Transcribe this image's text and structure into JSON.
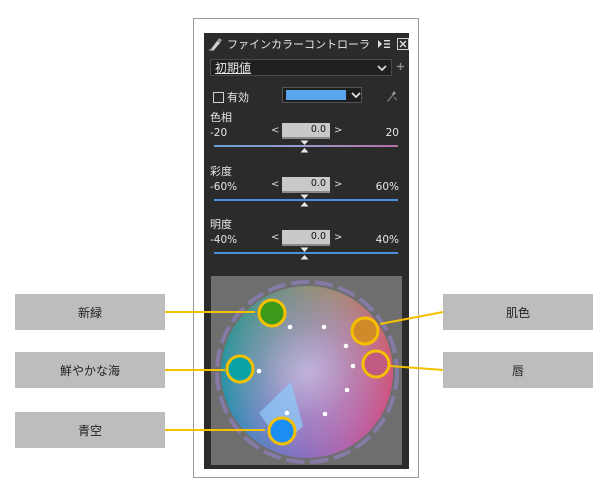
{
  "panel": {
    "title": "ファインカラーコントローラ",
    "preset_value": "初期値",
    "enable_label": "有効",
    "selected_color": "#5aa6ee"
  },
  "sliders": [
    {
      "label": "色相",
      "min_label": "-20",
      "max_label": "20",
      "value": "0.0",
      "track_color": "#7aa9d6"
    },
    {
      "label": "彩度",
      "min_label": "-60%",
      "max_label": "60%",
      "value": "0.0",
      "track_color": "#4a90d9"
    },
    {
      "label": "明度",
      "min_label": "-40%",
      "max_label": "40%",
      "value": "0.0",
      "track_color": "#4a90d9"
    }
  ],
  "callouts": [
    {
      "label": "新緑",
      "side": "left",
      "color_hint": "#5a9e1e"
    },
    {
      "label": "鮮やかな海",
      "side": "left",
      "color_hint": "#1aa8a0"
    },
    {
      "label": "青空",
      "side": "left",
      "color_hint": "#1e8ef0"
    },
    {
      "label": "肌色",
      "side": "right",
      "color_hint": "#d9a24a"
    },
    {
      "label": "唇",
      "side": "right",
      "color_hint": "#d05a7a"
    }
  ],
  "colors": {
    "panel_bg": "#2b2b2b",
    "callout_bg": "#bdbdbd",
    "leader_line": "#f5c000",
    "wheel_bg": "#6e6e6e"
  }
}
